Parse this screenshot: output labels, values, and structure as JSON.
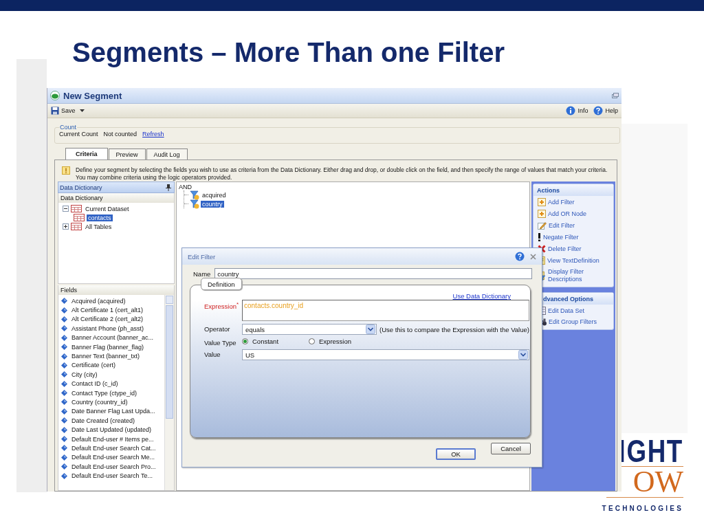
{
  "slide": {
    "title": "Segments – More Than one Filter"
  },
  "window": {
    "title": "New Segment"
  },
  "toolbar": {
    "save": "Save",
    "info": "Info",
    "help": "Help"
  },
  "count": {
    "legend": "Count",
    "label": "Current Count",
    "value": "Not counted",
    "link": "Refresh"
  },
  "tabs": [
    {
      "label": "Criteria",
      "selected": true
    },
    {
      "label": "Preview",
      "selected": false
    },
    {
      "label": "Audit Log",
      "selected": false
    }
  ],
  "info_text": "Define your segment by selecting the fields you wish to use as criteria from the Data Dictionary.  Either drag and drop, or double click on the field, and then specify the range of values that match your criteria. You may combine criteria using the logic operators provided.",
  "data_dictionary": {
    "title": "Data Dictionary",
    "subtitle": "Data Dictionary",
    "tree": [
      {
        "label": "Current Dataset",
        "expanded": true,
        "selected": false,
        "children": [
          {
            "label": "contacts",
            "selected": true
          }
        ]
      },
      {
        "label": "All Tables",
        "expanded": false,
        "selected": false
      }
    ]
  },
  "fields": {
    "title": "Fields",
    "items": [
      "Acquired (acquired)",
      "Alt Certificate 1 (cert_alt1)",
      "Alt Certificate 2 (cert_alt2)",
      "Assistant Phone (ph_asst)",
      "Banner Account (banner_ac...",
      "Banner Flag (banner_flag)",
      "Banner Text (banner_txt)",
      "Certificate (cert)",
      "City (city)",
      "Contact ID (c_id)",
      "Contact Type (ctype_id)",
      "Country (country_id)",
      "Date Banner Flag Last Upda...",
      "Date Created (created)",
      "Date Last Updated (updated)",
      "Default End-user # Items pe...",
      "Default End-user Search Cat...",
      "Default End-user Search Me...",
      "Default End-user Search Pro...",
      "Default End-user Search Te..."
    ]
  },
  "criteria": {
    "root": "AND",
    "children": [
      {
        "label": "acquired",
        "selected": false
      },
      {
        "label": "country",
        "selected": true
      }
    ]
  },
  "actions": {
    "title": "Actions",
    "items": [
      {
        "label": "Add Filter",
        "kind": "add"
      },
      {
        "label": "Add OR Node",
        "kind": "add"
      },
      {
        "label": "Edit Filter",
        "kind": "edit"
      },
      {
        "label": "Negate Filter",
        "kind": "negate"
      },
      {
        "label": "Delete Filter",
        "kind": "delete"
      },
      {
        "label": "View TextDefinition",
        "kind": "text"
      },
      {
        "label": "Display Filter Descriptions",
        "kind": "filter"
      }
    ]
  },
  "advanced": {
    "title": "dvanced Options",
    "items": [
      {
        "label": "Edit Data Set",
        "kind": "dataset"
      },
      {
        "label": "Edit Group Filters",
        "kind": "group"
      }
    ]
  },
  "dialog": {
    "title": "Edit Filter",
    "name_label": "Name",
    "name_value": "country",
    "tab": "Definition",
    "link": "Use Data Dictionary",
    "expression_label": "Expression",
    "required_mark": "*",
    "expression": "contacts.country_id",
    "operator_label": "Operator",
    "operator": "equals",
    "operator_hint": "(Use this to compare the Expression with the Value)",
    "value_type_label": "Value Type",
    "value_types": [
      {
        "label": "Constant",
        "selected": true
      },
      {
        "label": "Expression",
        "selected": false
      }
    ],
    "value_label": "Value",
    "value": "US",
    "buttons": [
      {
        "label": "OK",
        "default": true
      },
      {
        "label": "Cancel",
        "default": false
      }
    ]
  },
  "logo": {
    "line1": "IGHT",
    "line2": "OW",
    "line3": "TECHNOLOGIES"
  }
}
